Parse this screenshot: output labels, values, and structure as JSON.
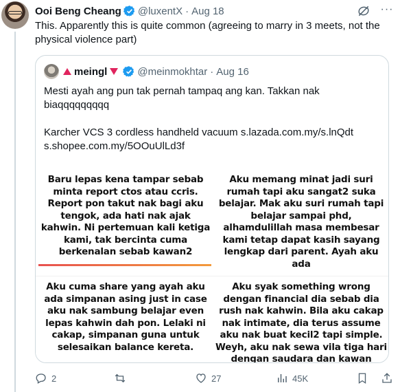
{
  "post": {
    "author_name": "Ooi Beng Cheang",
    "handle": "@luxentX",
    "date": "Aug 18",
    "text": "This. Apparently this is quite common (agreeing to marry in 3 meets, not the physical violence part)"
  },
  "quoted": {
    "author_name": "meingl",
    "handle": "@meinmokhtar",
    "date": "Aug 16",
    "line1": "Mesti ayah ang pun tak pernah tampaq ang kan. Takkan nak biaqqqqqqqqq",
    "line2": "Karcher VCS 3 cordless handheld vacuum s.lazada.com.my/s.lnQdt",
    "line3": "s.shopee.com.my/5OOuUlLd3f",
    "panels": [
      "Baru lepas kena tampar sebab minta report ctos atau ccris. Report pon takut nak bagi aku tengok, ada hati nak ajak kahwin. Ni pertemuan kali ketiga kami, tak bercinta cuma berkenalan sebab kawan2",
      "Aku memang minat jadi suri rumah tapi aku sangat2 suka belajar. Mak aku suri rumah tapi belajar sampai phd, alhamdulillah masa membesar kami tetap dapat kasih sayang lengkap dari parent. Ayah aku ada",
      "Aku cuma share yang ayah aku ada simpanan asing just in case aku nak sambung belajar even lepas kahwin dah pon. Lelaki ni cakap, simpanan guna untuk selesaikan balance kereta.",
      "Aku syak something wrong dengan financial dia sebab dia rush nak kahwin. Bila aku cakap nak intimate, dia terus assume aku nak buat kecil2 tapi simple. Weyh, aku nak sewa vila tiga hari dengan saudara dan kawan"
    ]
  },
  "actions": {
    "replies": "2",
    "reposts": "",
    "likes": "27",
    "views": "45K"
  },
  "colors": {
    "verified": "#1d9bf0",
    "muted": "#536471",
    "accent_red": "#e0245e"
  },
  "icons": [
    "verified-badge-icon",
    "grok-icon",
    "more-icon",
    "reply-icon",
    "repost-icon",
    "like-icon",
    "views-icon",
    "bookmark-icon",
    "share-icon"
  ]
}
